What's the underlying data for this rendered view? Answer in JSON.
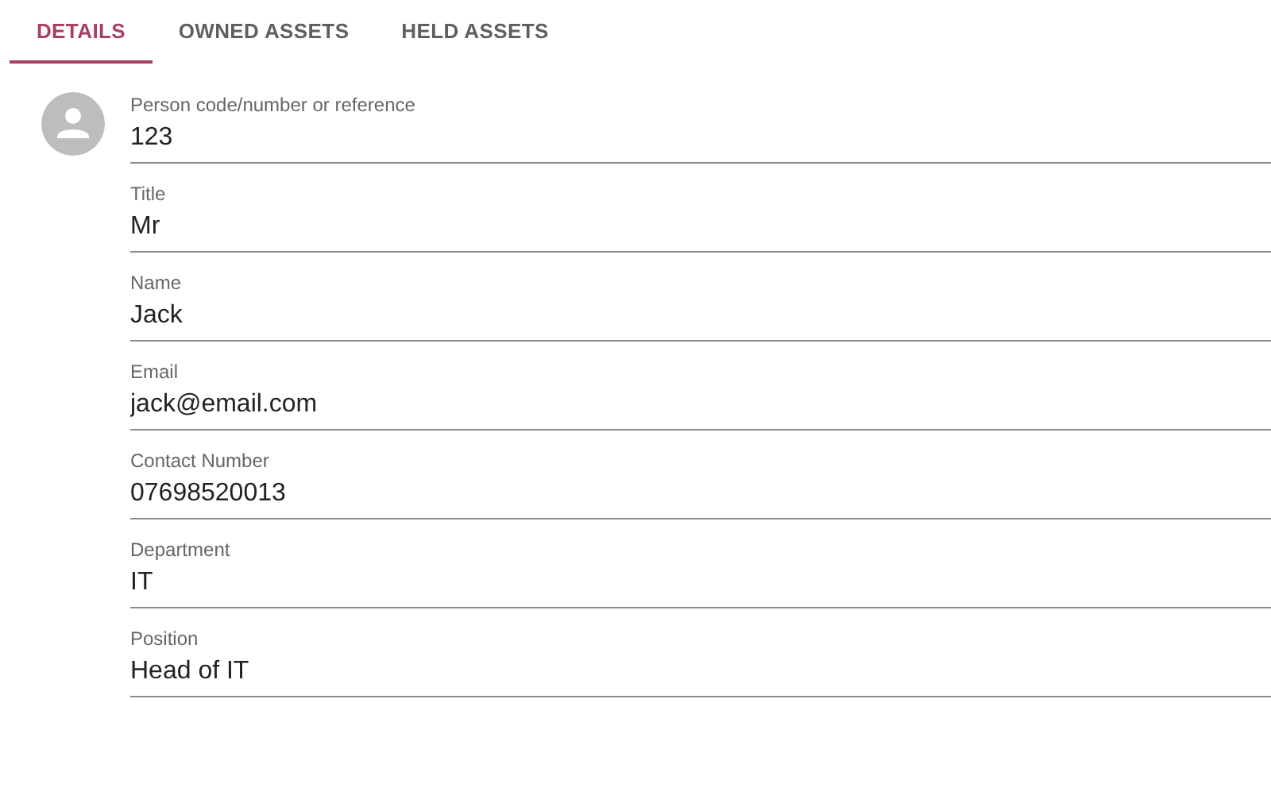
{
  "tabs": [
    {
      "label": "DETAILS",
      "selected": true
    },
    {
      "label": "OWNED ASSETS",
      "selected": false
    },
    {
      "label": "HELD ASSETS",
      "selected": false
    }
  ],
  "fields": [
    {
      "label": "Person code/number or reference",
      "value": "123"
    },
    {
      "label": "Title",
      "value": "Mr"
    },
    {
      "label": "Name",
      "value": "Jack"
    },
    {
      "label": "Email",
      "value": "jack@email.com"
    },
    {
      "label": "Contact Number",
      "value": "07698520013"
    },
    {
      "label": "Department",
      "value": "IT"
    },
    {
      "label": "Position",
      "value": "Head of IT"
    }
  ]
}
